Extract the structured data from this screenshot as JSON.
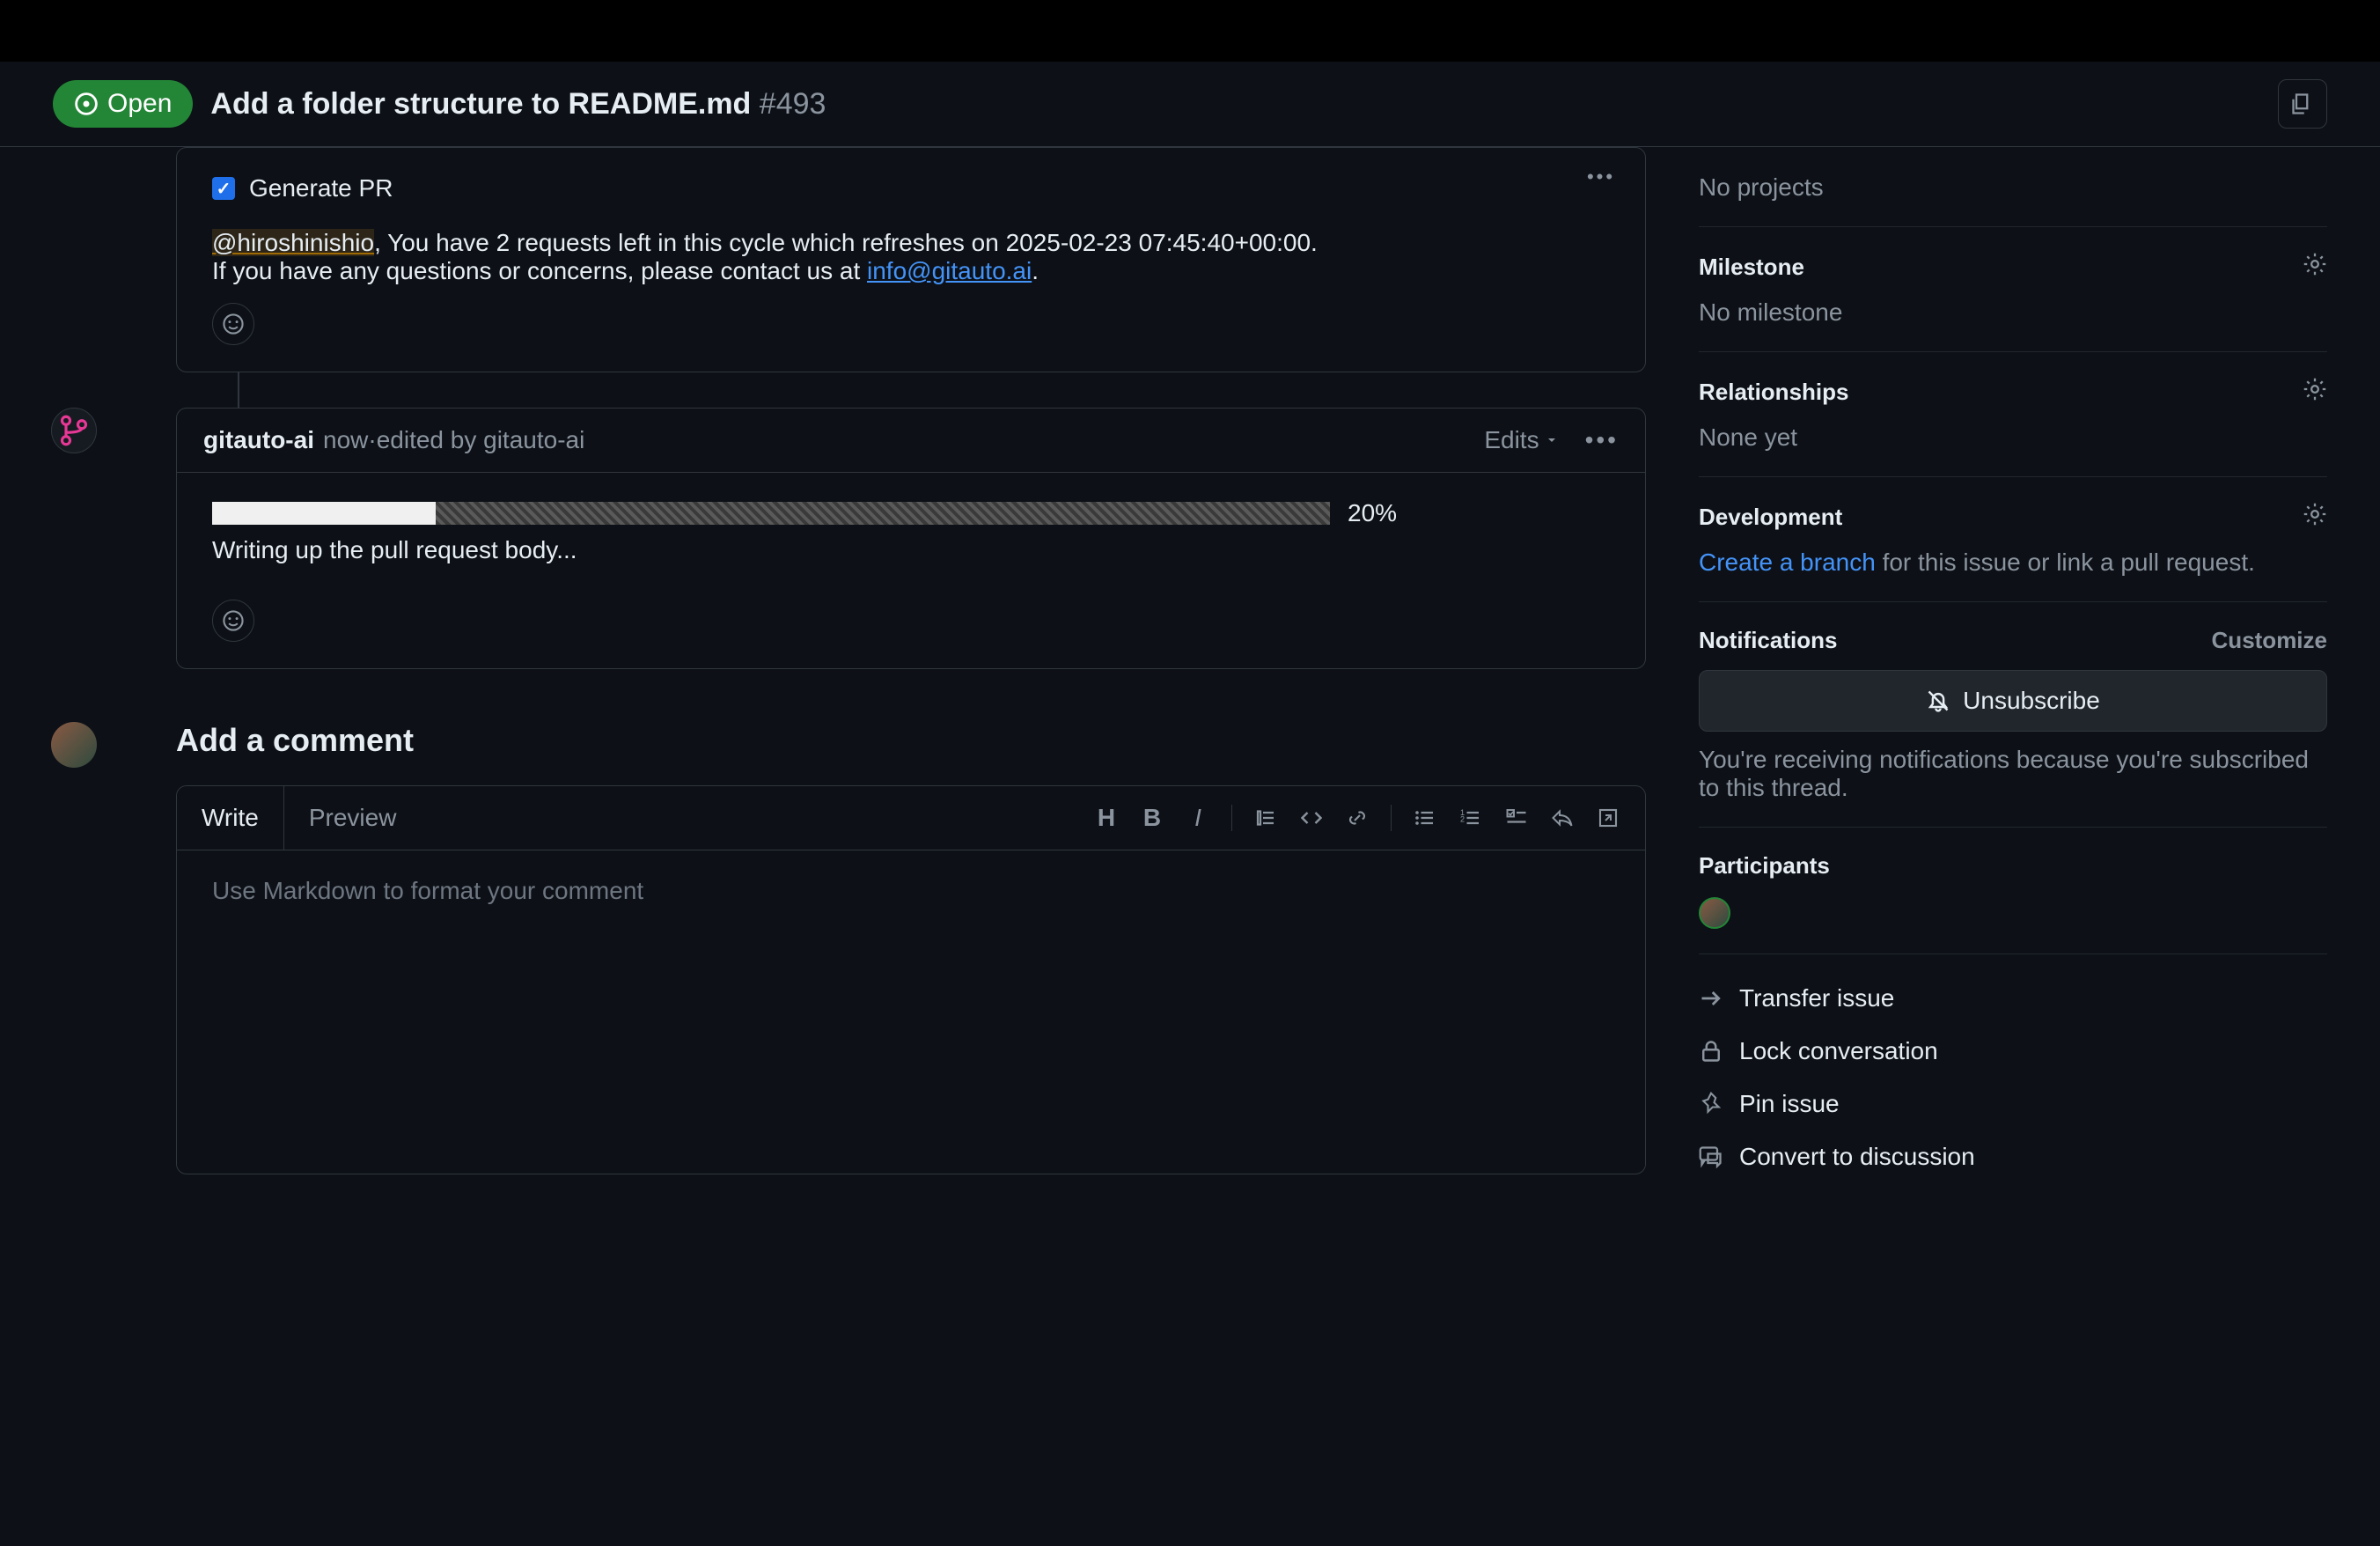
{
  "header": {
    "status": "Open",
    "title": "Add a folder structure to README.md",
    "number": "#493"
  },
  "comment1": {
    "checkbox_label": "Generate PR",
    "mention": "@hiroshinishio",
    "text_after_mention": ", You have 2 requests left in this cycle which refreshes on 2025-02-23 07:45:40+00:00.",
    "line2_pre": "If you have any questions or concerns, please contact us at ",
    "email": "info@gitauto.ai",
    "line2_post": "."
  },
  "comment2": {
    "author": "gitauto-ai",
    "time": "now",
    "edited_sep": " · ",
    "edited_text": "edited by gitauto-ai",
    "edits_label": "Edits",
    "progress_pct": "20%",
    "progress_text": "Writing up the pull request body..."
  },
  "addComment": {
    "heading": "Add a comment",
    "tab_write": "Write",
    "tab_preview": "Preview",
    "placeholder": "Use Markdown to format your comment"
  },
  "sidebar": {
    "projects_value": "No projects",
    "milestone_title": "Milestone",
    "milestone_value": "No milestone",
    "relationships_title": "Relationships",
    "relationships_value": "None yet",
    "development_title": "Development",
    "dev_link": "Create a branch",
    "dev_rest": " for this issue or link a pull request.",
    "notifications_title": "Notifications",
    "customize": "Customize",
    "unsubscribe": "Unsubscribe",
    "notif_desc": "You're receiving notifications because you're subscribed to this thread.",
    "participants_title": "Participants",
    "actions": {
      "transfer": "Transfer issue",
      "lock": "Lock conversation",
      "pin": "Pin issue",
      "convert": "Convert to discussion"
    }
  }
}
